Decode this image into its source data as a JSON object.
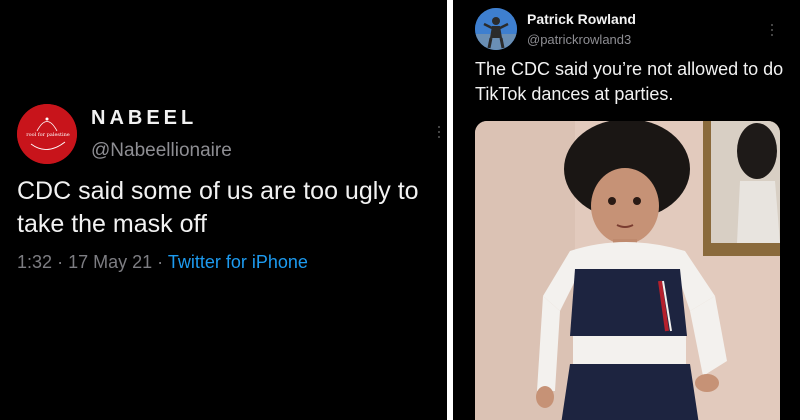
{
  "tweet_left": {
    "author_name": "NABEEL",
    "author_handle": "@Nabeellionaire",
    "avatar_caption": "rool for palestine",
    "text": "CDC said some of us are too ugly to take the mask off",
    "time": "1:32",
    "date": "17 May 21",
    "separator": "·",
    "source": "Twitter for iPhone",
    "more_icon": "vertical-ellipsis-icon"
  },
  "tweet_right": {
    "author_name": "Patrick Rowland",
    "author_handle": "@patrickrowland3",
    "text": "The CDC said you’re not allowed to do TikTok dances at parties.",
    "more_icon": "vertical-ellipsis-icon"
  },
  "colors": {
    "background": "#000000",
    "divider": "#ffffff",
    "text_primary": "#f2f2f2",
    "text_secondary": "#8e8e93",
    "link": "#1d9bf0",
    "left_avatar": "#c8141b"
  }
}
